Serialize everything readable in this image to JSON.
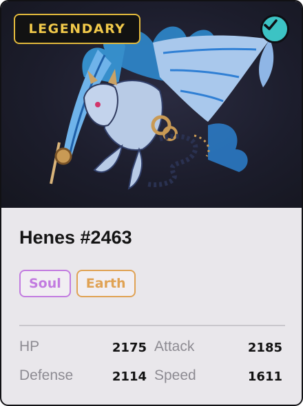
{
  "card": {
    "rarity": "LEGENDARY",
    "verified_icon": "check-icon",
    "name": "Henes #2463",
    "tags": [
      {
        "label": "Soul",
        "color": "#c27be0"
      },
      {
        "label": "Earth",
        "color": "#e0a254"
      }
    ],
    "stats": {
      "hp": {
        "label": "HP",
        "value": "2175"
      },
      "attack": {
        "label": "Attack",
        "value": "2185"
      },
      "defense": {
        "label": "Defense",
        "value": "2114"
      },
      "speed": {
        "label": "Speed",
        "value": "1611"
      }
    }
  },
  "colors": {
    "accent_gold": "#f1c94a",
    "verified_teal": "#3cc3c4",
    "art_background": "#1c1d2c"
  }
}
